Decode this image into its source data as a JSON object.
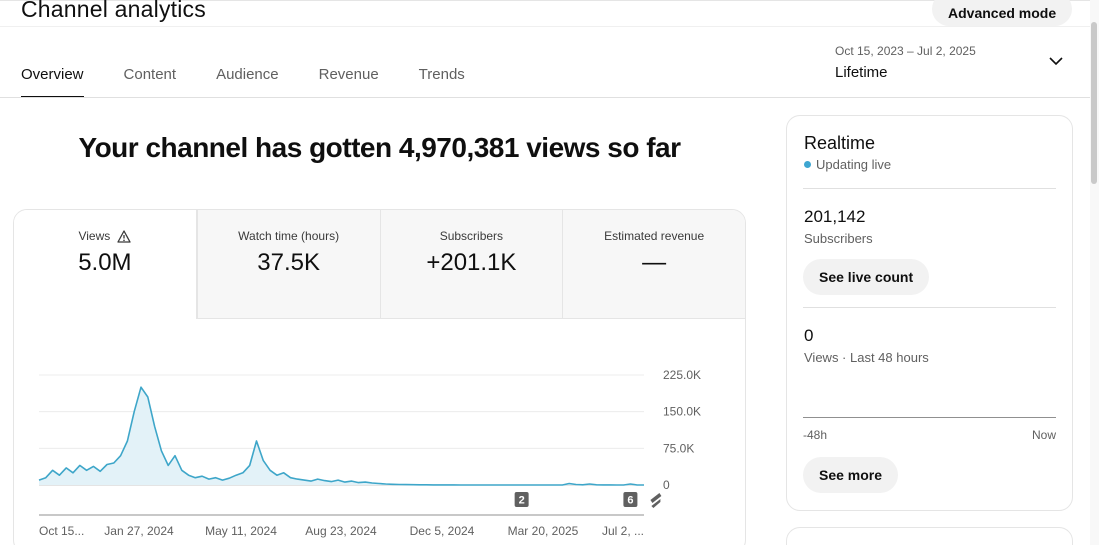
{
  "header": {
    "title": "Channel analytics",
    "advanced_mode": "Advanced mode"
  },
  "tabs": [
    {
      "label": "Overview",
      "active": true
    },
    {
      "label": "Content",
      "active": false
    },
    {
      "label": "Audience",
      "active": false
    },
    {
      "label": "Revenue",
      "active": false
    },
    {
      "label": "Trends",
      "active": false
    }
  ],
  "date_range": {
    "range": "Oct 15, 2023 – Jul 2, 2025",
    "label": "Lifetime",
    "icon": "chevron-down-icon"
  },
  "headline": "Your channel has gotten 4,970,381 views so far",
  "metrics": [
    {
      "label": "Views",
      "value": "5.0M",
      "icon": "warning-icon"
    },
    {
      "label": "Watch time (hours)",
      "value": "37.5K"
    },
    {
      "label": "Subscribers",
      "value": "+201.1K"
    },
    {
      "label": "Estimated revenue",
      "value": "—"
    }
  ],
  "chart_data": {
    "type": "area",
    "y_ticks": [
      "225.0K",
      "150.0K",
      "75.0K",
      "0"
    ],
    "ylim": [
      0,
      225000
    ],
    "x_tick_labels": [
      "Oct 15...",
      "Jan 27, 2024",
      "May 11, 2024",
      "Aug 23, 2024",
      "Dec 5, 2024",
      "Mar 20, 2025",
      "Jul 2, ..."
    ],
    "series": [
      {
        "values": [
          10000,
          15000,
          30000,
          20000,
          35000,
          25000,
          40000,
          30000,
          38000,
          28000,
          42000,
          45000,
          60000,
          90000,
          150000,
          200000,
          180000,
          120000,
          70000,
          40000,
          60000,
          30000,
          20000,
          15000,
          18000,
          12000,
          15000,
          10000,
          14000,
          20000,
          25000,
          40000,
          90000,
          50000,
          30000,
          20000,
          25000,
          15000,
          12000,
          10000,
          8000,
          12000,
          9000,
          7000,
          10000,
          6000,
          8000,
          5000,
          6000,
          4000,
          3000,
          2000,
          1500,
          1000,
          800,
          600,
          500,
          400,
          300,
          200,
          200,
          150,
          100,
          100,
          80,
          80,
          60,
          60,
          50,
          50,
          40,
          40,
          30,
          30,
          20,
          20,
          20,
          20,
          3000,
          1000,
          500,
          2000,
          500,
          300,
          200,
          100,
          100,
          2000,
          100,
          100
        ]
      }
    ],
    "annotations": [
      {
        "label": "2",
        "x_index": 71
      },
      {
        "label": "6",
        "x_index": 87
      }
    ]
  },
  "realtime": {
    "title": "Realtime",
    "status": "Updating live",
    "subscribers_value": "201,142",
    "subscribers_label": "Subscribers",
    "see_live_count": "See live count",
    "views_value": "0",
    "views_label": "Views · Last 48 hours",
    "axis_left": "-48h",
    "axis_right": "Now",
    "see_more": "See more"
  }
}
